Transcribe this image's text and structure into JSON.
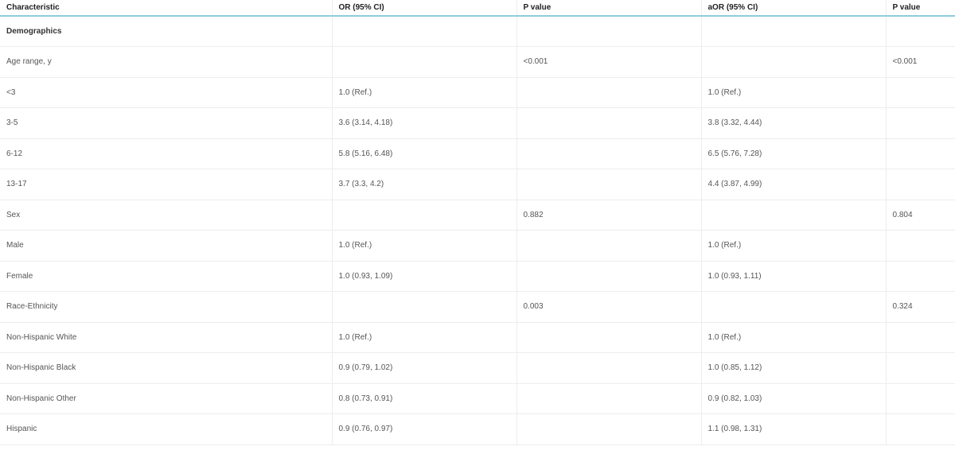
{
  "table": {
    "headers": [
      "Characteristic",
      "OR (95% CI)",
      "P value",
      "aOR (95% CI)",
      "P value"
    ],
    "rows": [
      {
        "cells": [
          "Demographics",
          "",
          "",
          "",
          ""
        ],
        "section": true
      },
      {
        "cells": [
          "Age range, y",
          "",
          "<0.001",
          "",
          "<0.001"
        ]
      },
      {
        "cells": [
          "<3",
          "1.0 (Ref.)",
          "",
          "1.0 (Ref.)",
          ""
        ]
      },
      {
        "cells": [
          "3-5",
          "3.6 (3.14, 4.18)",
          "",
          "3.8 (3.32, 4.44)",
          ""
        ]
      },
      {
        "cells": [
          "6-12",
          "5.8 (5.16, 6.48)",
          "",
          "6.5 (5.76, 7.28)",
          ""
        ]
      },
      {
        "cells": [
          "13-17",
          "3.7 (3.3, 4.2)",
          "",
          "4.4 (3.87, 4.99)",
          ""
        ]
      },
      {
        "cells": [
          "Sex",
          "",
          "0.882",
          "",
          "0.804"
        ]
      },
      {
        "cells": [
          "Male",
          "1.0 (Ref.)",
          "",
          "1.0 (Ref.)",
          ""
        ]
      },
      {
        "cells": [
          "Female",
          "1.0 (0.93, 1.09)",
          "",
          "1.0 (0.93, 1.11)",
          ""
        ]
      },
      {
        "cells": [
          "Race-Ethnicity",
          "",
          "0.003",
          "",
          "0.324"
        ]
      },
      {
        "cells": [
          "Non-Hispanic White",
          "1.0 (Ref.)",
          "",
          "1.0 (Ref.)",
          ""
        ]
      },
      {
        "cells": [
          "Non-Hispanic Black",
          "0.9 (0.79, 1.02)",
          "",
          "1.0 (0.85, 1.12)",
          ""
        ]
      },
      {
        "cells": [
          "Non-Hispanic Other",
          "0.8 (0.73, 0.91)",
          "",
          "0.9 (0.82, 1.03)",
          ""
        ]
      },
      {
        "cells": [
          "Hispanic",
          "0.9 (0.76, 0.97)",
          "",
          "1.1 (0.98, 1.31)",
          ""
        ]
      }
    ]
  }
}
